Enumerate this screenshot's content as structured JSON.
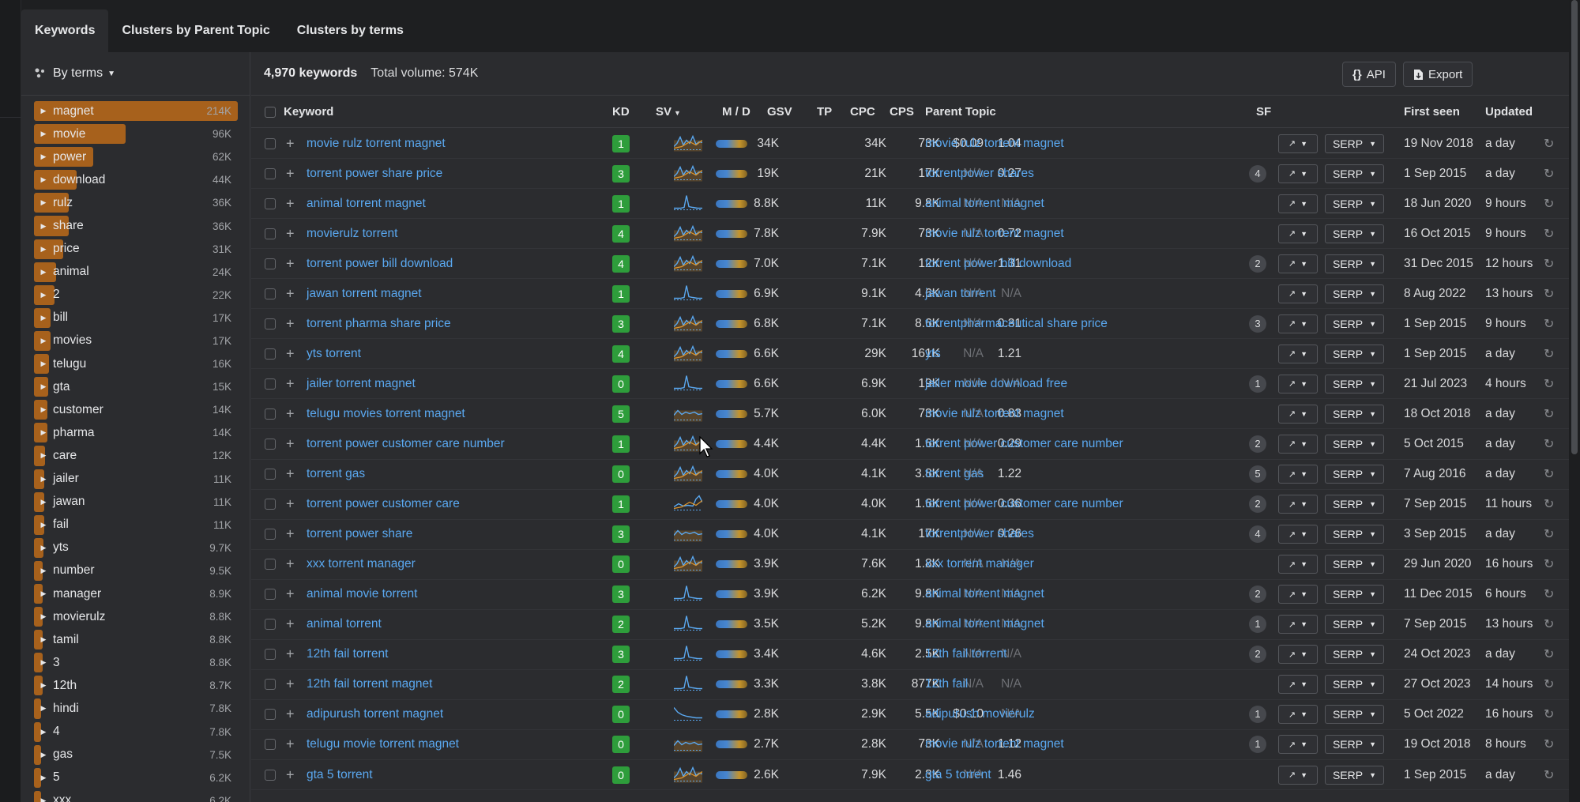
{
  "tabs": [
    "Keywords",
    "Clusters by Parent Topic",
    "Clusters by terms"
  ],
  "sidebar": {
    "mode_label": "By terms",
    "terms": [
      {
        "label": "magnet",
        "count": "214K",
        "fill": 1.0
      },
      {
        "label": "movie",
        "count": "96K",
        "fill": 0.45
      },
      {
        "label": "power",
        "count": "62K",
        "fill": 0.29
      },
      {
        "label": "download",
        "count": "44K",
        "fill": 0.21
      },
      {
        "label": "rulz",
        "count": "36K",
        "fill": 0.17
      },
      {
        "label": "share",
        "count": "36K",
        "fill": 0.17
      },
      {
        "label": "price",
        "count": "31K",
        "fill": 0.145
      },
      {
        "label": "animal",
        "count": "24K",
        "fill": 0.11
      },
      {
        "label": "2",
        "count": "22K",
        "fill": 0.1
      },
      {
        "label": "bill",
        "count": "17K",
        "fill": 0.08
      },
      {
        "label": "movies",
        "count": "17K",
        "fill": 0.08
      },
      {
        "label": "telugu",
        "count": "16K",
        "fill": 0.075
      },
      {
        "label": "gta",
        "count": "15K",
        "fill": 0.07
      },
      {
        "label": "customer",
        "count": "14K",
        "fill": 0.065
      },
      {
        "label": "pharma",
        "count": "14K",
        "fill": 0.065
      },
      {
        "label": "care",
        "count": "12K",
        "fill": 0.056
      },
      {
        "label": "jailer",
        "count": "11K",
        "fill": 0.051
      },
      {
        "label": "jawan",
        "count": "11K",
        "fill": 0.051
      },
      {
        "label": "fail",
        "count": "11K",
        "fill": 0.051
      },
      {
        "label": "yts",
        "count": "9.7K",
        "fill": 0.045
      },
      {
        "label": "number",
        "count": "9.5K",
        "fill": 0.044
      },
      {
        "label": "manager",
        "count": "8.9K",
        "fill": 0.042
      },
      {
        "label": "movierulz",
        "count": "8.8K",
        "fill": 0.041
      },
      {
        "label": "tamil",
        "count": "8.8K",
        "fill": 0.041
      },
      {
        "label": "3",
        "count": "8.8K",
        "fill": 0.041
      },
      {
        "label": "12th",
        "count": "8.7K",
        "fill": 0.041
      },
      {
        "label": "hindi",
        "count": "7.8K",
        "fill": 0.036
      },
      {
        "label": "4",
        "count": "7.8K",
        "fill": 0.036
      },
      {
        "label": "gas",
        "count": "7.5K",
        "fill": 0.035
      },
      {
        "label": "5",
        "count": "6.2K",
        "fill": 0.029
      },
      {
        "label": "xxx",
        "count": "6.2K",
        "fill": 0.029
      }
    ]
  },
  "toolbar": {
    "count_label": "4,970 keywords",
    "volume_label": "Total volume: 574K",
    "api_label": "API",
    "export_label": "Export"
  },
  "columns": {
    "keyword": "Keyword",
    "kd": "KD",
    "sv": "SV",
    "md": "M / D",
    "gsv": "GSV",
    "tp": "TP",
    "cpc": "CPC",
    "cps": "CPS",
    "parent": "Parent Topic",
    "sf": "SF",
    "first_seen": "First seen",
    "updated": "Updated"
  },
  "serp_label": "SERP",
  "kd_colors": {
    "0": "#2e9d3b",
    "1": "#2e9d3b",
    "2": "#2e9d3b",
    "3": "#2e9d3b",
    "4": "#2e9d3b",
    "5": "#2e9d3b"
  },
  "rows": [
    {
      "keyword": "movie rulz torrent magnet",
      "kd": "1",
      "sv": "34K",
      "gsv": "34K",
      "tp": "73K",
      "cpc": "$0.09",
      "cps": "1.04",
      "parent": "movie rulz torrent magnet",
      "sf": "",
      "first_seen": "19 Nov 2018",
      "updated": "a day",
      "spark": "mixed"
    },
    {
      "keyword": "torrent power share price",
      "kd": "3",
      "sv": "19K",
      "gsv": "21K",
      "tp": "17K",
      "cpc": "N/A",
      "cps": "0.27",
      "parent": "torrentpower shares",
      "sf": "4",
      "first_seen": "1 Sep 2015",
      "updated": "a day",
      "spark": "mixed"
    },
    {
      "keyword": "animal torrent magnet",
      "kd": "1",
      "sv": "8.8K",
      "gsv": "11K",
      "tp": "9.8K",
      "cpc": "N/A",
      "cps": "N/A",
      "parent": "animal torrent magnet",
      "sf": "",
      "first_seen": "18 Jun 2020",
      "updated": "9 hours",
      "spark": "spike"
    },
    {
      "keyword": "movierulz torrent",
      "kd": "4",
      "sv": "7.8K",
      "gsv": "7.9K",
      "tp": "73K",
      "cpc": "N/A",
      "cps": "0.72",
      "parent": "movie rulz torrent magnet",
      "sf": "",
      "first_seen": "16 Oct 2015",
      "updated": "9 hours",
      "spark": "mixed"
    },
    {
      "keyword": "torrent power bill download",
      "kd": "4",
      "sv": "7.0K",
      "gsv": "7.1K",
      "tp": "12K",
      "cpc": "N/A",
      "cps": "1.31",
      "parent": "torrent power bill download",
      "sf": "2",
      "first_seen": "31 Dec 2015",
      "updated": "12 hours",
      "spark": "mixed"
    },
    {
      "keyword": "jawan torrent magnet",
      "kd": "1",
      "sv": "6.9K",
      "gsv": "9.1K",
      "tp": "4.6K",
      "cpc": "N/A",
      "cps": "N/A",
      "parent": "jawan torrent",
      "sf": "",
      "first_seen": "8 Aug 2022",
      "updated": "13 hours",
      "spark": "spike"
    },
    {
      "keyword": "torrent pharma share price",
      "kd": "3",
      "sv": "6.8K",
      "gsv": "7.1K",
      "tp": "8.6K",
      "cpc": "N/A",
      "cps": "0.31",
      "parent": "torrentpharmaceutical share price",
      "sf": "3",
      "first_seen": "1 Sep 2015",
      "updated": "9 hours",
      "spark": "mixed"
    },
    {
      "keyword": "yts torrent",
      "kd": "4",
      "sv": "6.6K",
      "gsv": "29K",
      "tp": "161K",
      "cpc": "N/A",
      "cps": "1.21",
      "parent": "yts",
      "sf": "",
      "first_seen": "1 Sep 2015",
      "updated": "a day",
      "spark": "mixed"
    },
    {
      "keyword": "jailer torrent magnet",
      "kd": "0",
      "sv": "6.6K",
      "gsv": "6.9K",
      "tp": "19K",
      "cpc": "N/A",
      "cps": "N/A",
      "parent": "jailer movie download free",
      "sf": "1",
      "first_seen": "21 Jul 2023",
      "updated": "4 hours",
      "spark": "spike"
    },
    {
      "keyword": "telugu movies torrent magnet",
      "kd": "5",
      "sv": "5.7K",
      "gsv": "6.0K",
      "tp": "73K",
      "cpc": "N/A",
      "cps": "0.83",
      "parent": "movie rulz torrent magnet",
      "sf": "",
      "first_seen": "18 Oct 2018",
      "updated": "a day",
      "spark": "flat"
    },
    {
      "keyword": "torrent power customer care number",
      "kd": "1",
      "sv": "4.4K",
      "gsv": "4.4K",
      "tp": "1.6K",
      "cpc": "N/A",
      "cps": "0.29",
      "parent": "torrent power customer care number",
      "sf": "2",
      "first_seen": "5 Oct 2015",
      "updated": "a day",
      "spark": "mixed"
    },
    {
      "keyword": "torrent gas",
      "kd": "0",
      "sv": "4.0K",
      "gsv": "4.1K",
      "tp": "3.8K",
      "cpc": "N/A",
      "cps": "1.22",
      "parent": "torrent gas",
      "sf": "5",
      "first_seen": "7 Aug 2016",
      "updated": "a day",
      "spark": "mixed"
    },
    {
      "keyword": "torrent power customer care",
      "kd": "1",
      "sv": "4.0K",
      "gsv": "4.0K",
      "tp": "1.6K",
      "cpc": "N/A",
      "cps": "0.36",
      "parent": "torrent power customer care number",
      "sf": "2",
      "first_seen": "7 Sep 2015",
      "updated": "11 hours",
      "spark": "rise"
    },
    {
      "keyword": "torrent power share",
      "kd": "3",
      "sv": "4.0K",
      "gsv": "4.1K",
      "tp": "17K",
      "cpc": "N/A",
      "cps": "0.26",
      "parent": "torrentpower shares",
      "sf": "4",
      "first_seen": "3 Sep 2015",
      "updated": "a day",
      "spark": "flat"
    },
    {
      "keyword": "xxx torrent manager",
      "kd": "0",
      "sv": "3.9K",
      "gsv": "7.6K",
      "tp": "1.8K",
      "cpc": "N/A",
      "cps": "N/A",
      "parent": "xxx torrent manager",
      "sf": "",
      "first_seen": "29 Jun 2020",
      "updated": "16 hours",
      "spark": "mixed"
    },
    {
      "keyword": "animal movie torrent",
      "kd": "3",
      "sv": "3.9K",
      "gsv": "6.2K",
      "tp": "9.8K",
      "cpc": "N/A",
      "cps": "N/A",
      "parent": "animal torrent magnet",
      "sf": "2",
      "first_seen": "11 Dec 2015",
      "updated": "6 hours",
      "spark": "spike"
    },
    {
      "keyword": "animal torrent",
      "kd": "2",
      "sv": "3.5K",
      "gsv": "5.2K",
      "tp": "9.8K",
      "cpc": "N/A",
      "cps": "N/A",
      "parent": "animal torrent magnet",
      "sf": "1",
      "first_seen": "7 Sep 2015",
      "updated": "13 hours",
      "spark": "spike"
    },
    {
      "keyword": "12th fail torrent",
      "kd": "3",
      "sv": "3.4K",
      "gsv": "4.6K",
      "tp": "2.5K",
      "cpc": "N/A",
      "cps": "N/A",
      "parent": "12th fail torrent",
      "sf": "2",
      "first_seen": "24 Oct 2023",
      "updated": "a day",
      "spark": "spike"
    },
    {
      "keyword": "12th fail torrent magnet",
      "kd": "2",
      "sv": "3.3K",
      "gsv": "3.8K",
      "tp": "877K",
      "cpc": "N/A",
      "cps": "N/A",
      "parent": "12th fail",
      "sf": "",
      "first_seen": "27 Oct 2023",
      "updated": "14 hours",
      "spark": "spike"
    },
    {
      "keyword": "adipurush torrent magnet",
      "kd": "0",
      "sv": "2.8K",
      "gsv": "2.9K",
      "tp": "5.5K",
      "cpc": "$0.10",
      "cps": "N/A",
      "parent": "adipurush movierulz",
      "sf": "1",
      "first_seen": "5 Oct 2022",
      "updated": "16 hours",
      "spark": "decay"
    },
    {
      "keyword": "telugu movie torrent magnet",
      "kd": "0",
      "sv": "2.7K",
      "gsv": "2.8K",
      "tp": "73K",
      "cpc": "N/A",
      "cps": "1.12",
      "parent": "movie rulz torrent magnet",
      "sf": "1",
      "first_seen": "19 Oct 2018",
      "updated": "8 hours",
      "spark": "flat"
    },
    {
      "keyword": "gta 5 torrent",
      "kd": "0",
      "sv": "2.6K",
      "gsv": "7.9K",
      "tp": "2.3K",
      "cpc": "N/A",
      "cps": "1.46",
      "parent": "gta 5 torrent",
      "sf": "",
      "first_seen": "1 Sep 2015",
      "updated": "a day",
      "spark": "mixed"
    }
  ]
}
